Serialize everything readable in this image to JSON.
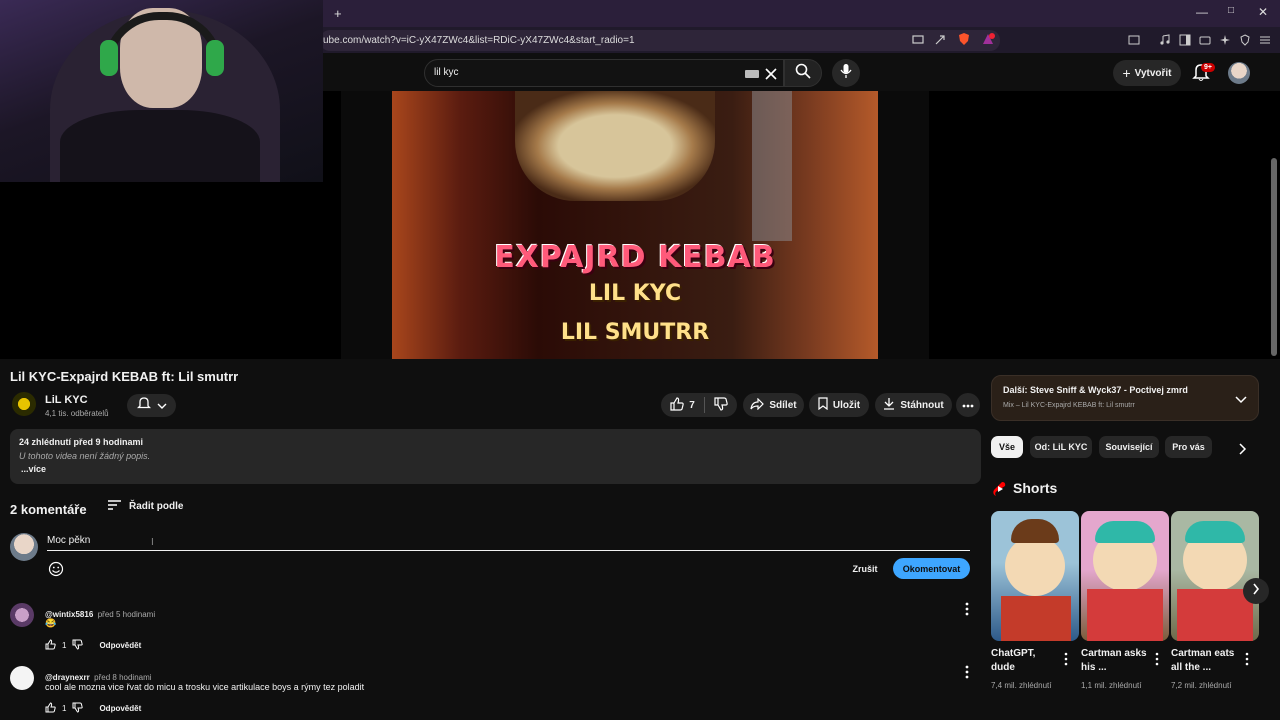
{
  "browser": {
    "url": "ube.com/watch?v=iC-yX47ZWc4&list=RDiC-yX47ZWc4&start_radio=1",
    "new_tab": "+",
    "window_controls": [
      "—",
      "□",
      "✕"
    ]
  },
  "search": {
    "query": "lil kyc"
  },
  "header": {
    "create_label": "Vytvořit",
    "notif_badge": "9+"
  },
  "video_art": {
    "title": "EXPAJRD KEBAB",
    "line1": "LIL KYC",
    "line2": "LIL SMUTRR"
  },
  "video": {
    "title": "Lil KYC-Expajrd KEBAB ft: Lil smutrr",
    "channel": "LiL KYC",
    "subscribers": "4,1 tis. odběratelů",
    "likes": "7",
    "share_label": "Sdílet",
    "save_label": "Uložit",
    "download_label": "Stáhnout"
  },
  "description": {
    "stats": "24 zhlédnutí  před 9 hodinami",
    "text": "U tohoto videa není žádný popis.",
    "more": "...více"
  },
  "comments": {
    "count_label": "2 komentáře",
    "sort_label": "Řadit podle",
    "draft": "Moc pěkn",
    "cancel_label": "Zrušit",
    "submit_label": "Okomentovat",
    "items": [
      {
        "author": "@wintix5816",
        "time": "před 5 hodinami",
        "text": "😂",
        "likes": "1",
        "reply": "Odpovědět"
      },
      {
        "author": "@draynexrr",
        "time": "před 8 hodinami",
        "text": "cool ale mozna vice řvat do micu a trosku vice artikulace boys a rýmy tez poladit",
        "likes": "1",
        "reply": "Odpovědět"
      }
    ]
  },
  "sidebar": {
    "next_title": "Další: Steve Sniff & Wyck37 - Poctivej zmrd",
    "next_sub": "Mix – Lil KYC-Expajrd KEBAB ft: Lil smutrr",
    "chips": [
      "Vše",
      "Od: LiL KYC",
      "Související",
      "Pro vás"
    ],
    "shorts_title": "Shorts",
    "shorts": [
      {
        "title": "ChatGPT, dude",
        "views": "7,4 mil. zhlédnutí"
      },
      {
        "title": "Cartman asks his ...",
        "views": "1,1 mil. zhlédnutí"
      },
      {
        "title": "Cartman eats all the ...",
        "views": "7,2 mil. zhlédnutí"
      }
    ]
  },
  "colors": {
    "accent": "#3ea6ff",
    "brand_red": "#cc0000"
  }
}
